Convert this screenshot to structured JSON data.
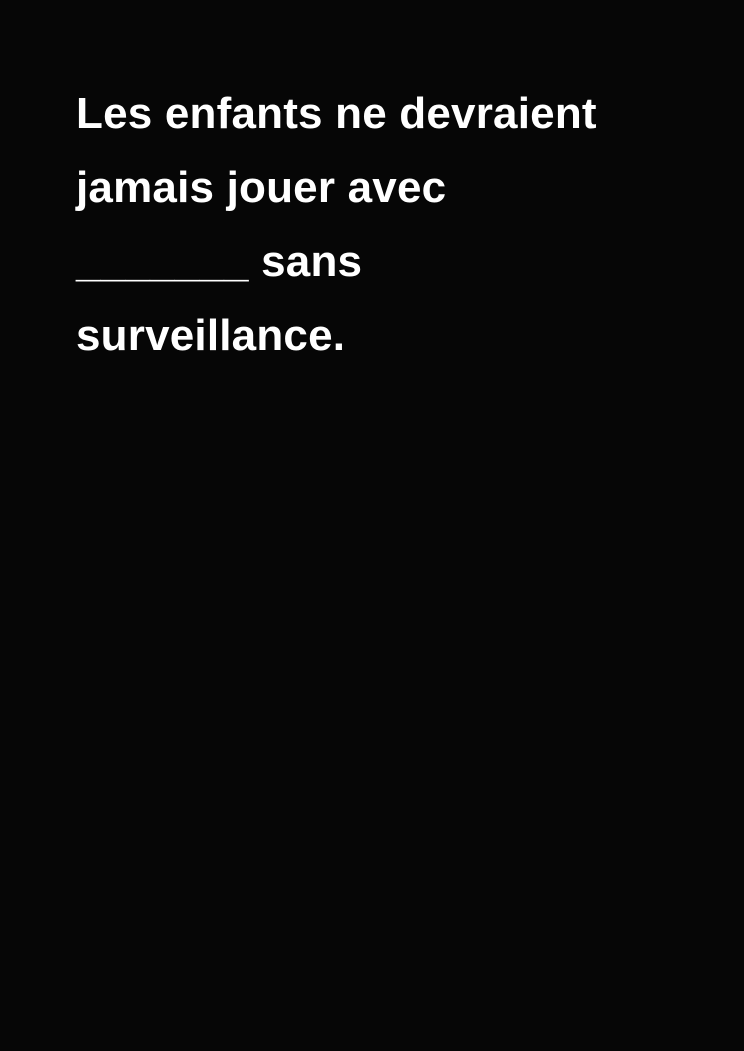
{
  "card": {
    "lines": [
      "Les enfants ne devraient",
      "jamais jouer avec",
      "_______ sans",
      "surveillance."
    ]
  },
  "colors": {
    "background": "#060606",
    "text": "#ffffff"
  }
}
